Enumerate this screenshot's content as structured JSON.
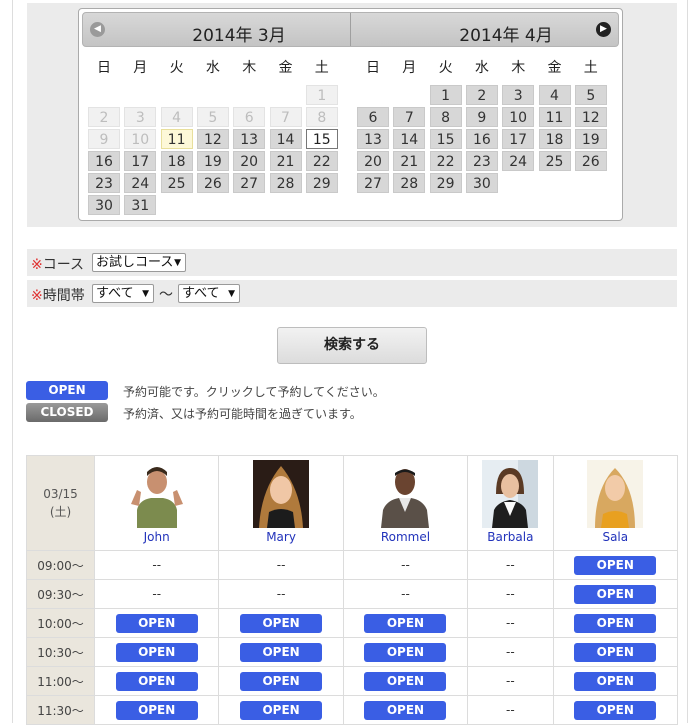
{
  "calendar": {
    "left_month": "2014年 3月",
    "right_month": "2014年 4月",
    "dow": [
      "日",
      "月",
      "火",
      "水",
      "木",
      "金",
      "土"
    ],
    "march": [
      [
        null,
        null,
        null,
        null,
        null,
        null,
        {
          "d": "1",
          "s": "off"
        }
      ],
      [
        {
          "d": "2",
          "s": "off"
        },
        {
          "d": "3",
          "s": "off"
        },
        {
          "d": "4",
          "s": "off"
        },
        {
          "d": "5",
          "s": "off"
        },
        {
          "d": "6",
          "s": "off"
        },
        {
          "d": "7",
          "s": "off"
        },
        {
          "d": "8",
          "s": "off"
        }
      ],
      [
        {
          "d": "9",
          "s": "off"
        },
        {
          "d": "10",
          "s": "off"
        },
        {
          "d": "11",
          "s": "today"
        },
        {
          "d": "12",
          "s": "on"
        },
        {
          "d": "13",
          "s": "on"
        },
        {
          "d": "14",
          "s": "on"
        },
        {
          "d": "15",
          "s": "sel"
        }
      ],
      [
        {
          "d": "16",
          "s": "on"
        },
        {
          "d": "17",
          "s": "on"
        },
        {
          "d": "18",
          "s": "on"
        },
        {
          "d": "19",
          "s": "on"
        },
        {
          "d": "20",
          "s": "on"
        },
        {
          "d": "21",
          "s": "on"
        },
        {
          "d": "22",
          "s": "on"
        }
      ],
      [
        {
          "d": "23",
          "s": "on"
        },
        {
          "d": "24",
          "s": "on"
        },
        {
          "d": "25",
          "s": "on"
        },
        {
          "d": "26",
          "s": "on"
        },
        {
          "d": "27",
          "s": "on"
        },
        {
          "d": "28",
          "s": "on"
        },
        {
          "d": "29",
          "s": "on"
        }
      ],
      [
        {
          "d": "30",
          "s": "on"
        },
        {
          "d": "31",
          "s": "on"
        },
        null,
        null,
        null,
        null,
        null
      ]
    ],
    "april": [
      [
        null,
        null,
        {
          "d": "1",
          "s": "on"
        },
        {
          "d": "2",
          "s": "on"
        },
        {
          "d": "3",
          "s": "on"
        },
        {
          "d": "4",
          "s": "on"
        },
        {
          "d": "5",
          "s": "on"
        }
      ],
      [
        {
          "d": "6",
          "s": "on"
        },
        {
          "d": "7",
          "s": "on"
        },
        {
          "d": "8",
          "s": "on"
        },
        {
          "d": "9",
          "s": "on"
        },
        {
          "d": "10",
          "s": "on"
        },
        {
          "d": "11",
          "s": "on"
        },
        {
          "d": "12",
          "s": "on"
        }
      ],
      [
        {
          "d": "13",
          "s": "on"
        },
        {
          "d": "14",
          "s": "on"
        },
        {
          "d": "15",
          "s": "on"
        },
        {
          "d": "16",
          "s": "on"
        },
        {
          "d": "17",
          "s": "on"
        },
        {
          "d": "18",
          "s": "on"
        },
        {
          "d": "19",
          "s": "on"
        }
      ],
      [
        {
          "d": "20",
          "s": "on"
        },
        {
          "d": "21",
          "s": "on"
        },
        {
          "d": "22",
          "s": "on"
        },
        {
          "d": "23",
          "s": "on"
        },
        {
          "d": "24",
          "s": "on"
        },
        {
          "d": "25",
          "s": "on"
        },
        {
          "d": "26",
          "s": "on"
        }
      ],
      [
        {
          "d": "27",
          "s": "on"
        },
        {
          "d": "28",
          "s": "on"
        },
        {
          "d": "29",
          "s": "on"
        },
        {
          "d": "30",
          "s": "on"
        },
        null,
        null,
        null
      ]
    ]
  },
  "filters": {
    "required_mark": "※",
    "course_label": "コース",
    "course_value": "お試しコース",
    "time_label": "時間帯",
    "time_from": "すべて",
    "tilde": "〜",
    "time_to": "すべて"
  },
  "search_label": "検索する",
  "legend": {
    "open_label": "OPEN",
    "open_text": "予約可能です。クリックして予約してください。",
    "closed_label": "CLOSED",
    "closed_text": "予約済、又は予約可能時間を過ぎています。"
  },
  "schedule": {
    "date": "03/15",
    "weekday": "(土)",
    "staff": [
      "John",
      "Mary",
      "Rommel",
      "Barbala",
      "Sala"
    ],
    "open_label": "OPEN",
    "closed_mark": "--",
    "rows": [
      {
        "time": "09:00〜",
        "slots": [
          0,
          0,
          0,
          0,
          1
        ]
      },
      {
        "time": "09:30〜",
        "slots": [
          0,
          0,
          0,
          0,
          1
        ]
      },
      {
        "time": "10:00〜",
        "slots": [
          1,
          1,
          1,
          0,
          1
        ]
      },
      {
        "time": "10:30〜",
        "slots": [
          1,
          1,
          1,
          0,
          1
        ]
      },
      {
        "time": "11:00〜",
        "slots": [
          1,
          1,
          1,
          0,
          1
        ]
      },
      {
        "time": "11:30〜",
        "slots": [
          1,
          1,
          1,
          0,
          1
        ]
      }
    ]
  },
  "colors": {
    "open": "#3a5ee4",
    "accent_required": "#e03030",
    "date_col": "#eae6dd"
  }
}
